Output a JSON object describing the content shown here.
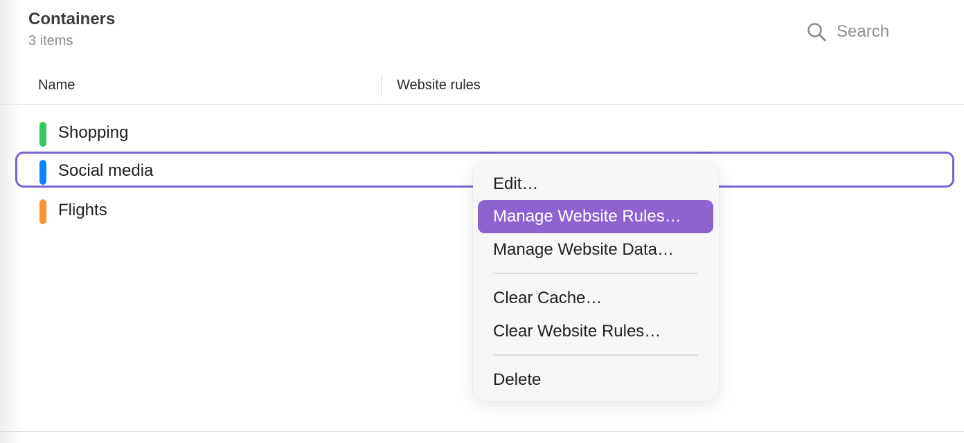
{
  "header": {
    "title": "Containers",
    "subtitle": "3 items"
  },
  "search": {
    "placeholder": "Search",
    "value": "",
    "icon": "search-icon"
  },
  "columns": {
    "name": "Name",
    "website_rules": "Website rules"
  },
  "rows": [
    {
      "label": "Shopping",
      "color": "#34c759",
      "selected": false
    },
    {
      "label": "Social media",
      "color": "#0a84ff",
      "selected": true
    },
    {
      "label": "Flights",
      "color": "#ff9230",
      "selected": false
    }
  ],
  "context_menu": {
    "items": [
      {
        "label": "Edit…",
        "highlighted": false
      },
      {
        "label": "Manage Website Rules…",
        "highlighted": true
      },
      {
        "label": "Manage Website Data…",
        "highlighted": false
      },
      {
        "label": "Clear Cache…",
        "highlighted": false
      },
      {
        "label": "Clear Website Rules…",
        "highlighted": false
      },
      {
        "label": "Delete",
        "highlighted": false
      }
    ]
  },
  "colors": {
    "accent": "#7a5fd0",
    "menu_highlight": "#8c63cf"
  }
}
